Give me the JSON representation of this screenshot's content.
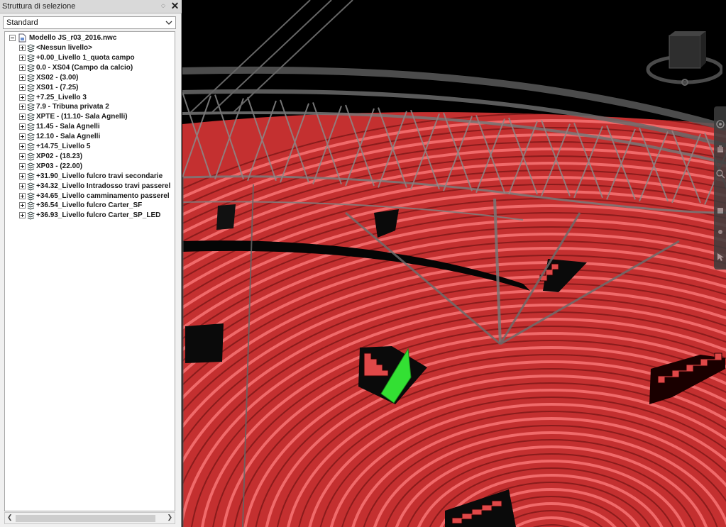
{
  "panel": {
    "title": "Struttura di selezione",
    "pin_icon": "pin-icon",
    "close_label": "✕",
    "mode_select": {
      "value": "Standard"
    }
  },
  "tree": {
    "root": {
      "label": "Modello JS_r03_2016.nwc",
      "icon": "model-file-icon",
      "expanded": true
    },
    "items": [
      {
        "label": "<Nessun livello>"
      },
      {
        "label": "+0.00_Livello 1_quota campo"
      },
      {
        "label": "0.0 - XS04 (Campo da calcio)"
      },
      {
        "label": "XS02 - (3.00)"
      },
      {
        "label": "XS01 - (7.25)"
      },
      {
        "label": "+7.25_Livello 3"
      },
      {
        "label": "7.9 - Tribuna privata 2"
      },
      {
        "label": "XPTE - (11.10- Sala Agnelli)"
      },
      {
        "label": "11.45 - Sala Agnelli"
      },
      {
        "label": "12.10 - Sala Agnelli"
      },
      {
        "label": "+14.75_Livello 5"
      },
      {
        "label": "XP02 - (18.23)"
      },
      {
        "label": "XP03 - (22.00)"
      },
      {
        "label": "+31.90_Livello fulcro travi secondarie"
      },
      {
        "label": "+34.32_Livello Intradosso travi passerel"
      },
      {
        "label": "+34.65_Livello camminamento passerel"
      },
      {
        "label": "+36.54_Livello fulcro Carter_SF"
      },
      {
        "label": "+36.93_Livello fulcro Carter_SP_LED"
      }
    ]
  },
  "viewport": {
    "seat_color": "#d93a3a",
    "seat_stripe_color": "#f06a6a",
    "selection_color": "#2fe02f",
    "truss_color": "#8a8a8a"
  }
}
